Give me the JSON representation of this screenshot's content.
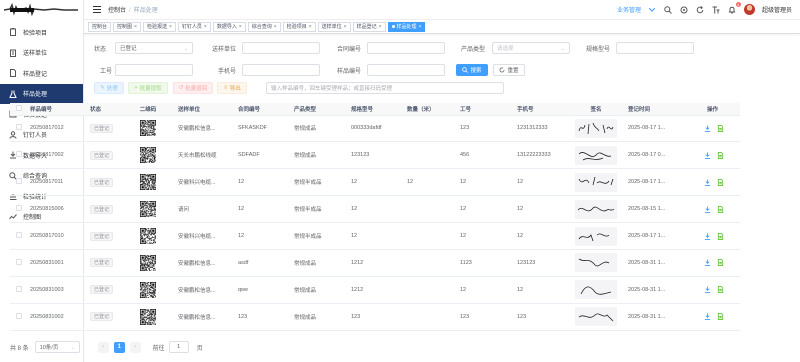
{
  "sidebar": {
    "items": [
      {
        "label": "检验项目",
        "icon": "clipboard-icon",
        "active": false
      },
      {
        "label": "送样单位",
        "icon": "building-icon",
        "active": false
      },
      {
        "label": "样品登记",
        "icon": "document-icon",
        "active": false
      },
      {
        "label": "样品处理",
        "icon": "flask-icon",
        "active": true
      },
      {
        "label": "检验报送",
        "icon": "report-icon",
        "active": false
      },
      {
        "label": "钉钉人员",
        "icon": "user-icon",
        "active": false
      },
      {
        "label": "数据导入",
        "icon": "import-icon",
        "active": false
      },
      {
        "label": "综合查询",
        "icon": "search-icon",
        "active": false
      },
      {
        "label": "检验统计",
        "icon": "chart-icon",
        "active": false
      },
      {
        "label": "控制图",
        "icon": "graph-icon",
        "active": false
      }
    ]
  },
  "header": {
    "breadcrumb_home": "控制台",
    "breadcrumb_current": "样品处理",
    "biz_menu": "业务管理",
    "notification_count": "1",
    "user_name": "超级管理员"
  },
  "tabs": [
    {
      "label": "控制台",
      "active": false
    },
    {
      "label": "控制图",
      "active": false
    },
    {
      "label": "检验报送",
      "active": false
    },
    {
      "label": "钉钉人员",
      "active": false
    },
    {
      "label": "数据导入",
      "active": false
    },
    {
      "label": "综合查询",
      "active": false
    },
    {
      "label": "检验项目",
      "active": false
    },
    {
      "label": "送样单位",
      "active": false
    },
    {
      "label": "样品登记",
      "active": false
    },
    {
      "label": "样品处理",
      "active": true
    }
  ],
  "filters": {
    "status_label": "状态",
    "status_value": "已登记",
    "unit_label": "送样单位",
    "contract_label": "合同编号",
    "product_type_label": "产品类型",
    "product_type_placeholder": "请选择",
    "spec_label": "规格型号",
    "worker_label": "工号",
    "phone_label": "手机号",
    "sample_label": "样品编号",
    "search_label": "搜索",
    "reset_label": "重置"
  },
  "toolbar": {
    "process_label": "处理",
    "batch_label": "批量提取",
    "batch_return_label": "批量退回",
    "export_label": "导出",
    "scan_placeholder": "输入样品编号，回车键受理样品；或直接扫码受理"
  },
  "table": {
    "headers": [
      "样品编号",
      "状态",
      "二维码",
      "送样单位",
      "合同编号",
      "产品类型",
      "规格型号",
      "数量（米）",
      "工号",
      "手机号",
      "签名",
      "登记时间",
      "操作"
    ],
    "rows": [
      {
        "sample": "20250817012",
        "status": "已登记",
        "unit": "安徽鹏松信息...",
        "contract": "SFKASKDF",
        "type": "常规成品",
        "spec": "000333dafdf",
        "qty": "",
        "worker": "123",
        "phone": "1231312333",
        "time": "2025-08-17 1..."
      },
      {
        "sample": "20250817002",
        "status": "已登记",
        "unit": "天长市鹏松线缆",
        "contract": "SDFADF",
        "type": "常规成品",
        "spec": "123123",
        "qty": "",
        "worker": "456",
        "phone": "13122223333",
        "time": "2025-08-17 0..."
      },
      {
        "sample": "20250817011",
        "status": "已登记",
        "unit": "安徽科兴电缆...",
        "contract": "12",
        "type": "常规半成品",
        "spec": "12",
        "qty": "12",
        "worker": "12",
        "phone": "12",
        "time": "2025-08-17 1..."
      },
      {
        "sample": "20250815006",
        "status": "已登记",
        "unit": "请问",
        "contract": "12",
        "type": "常规半成品",
        "spec": "12",
        "qty": "",
        "worker": "12",
        "phone": "12",
        "time": "2025-08-15 1..."
      },
      {
        "sample": "20250817010",
        "status": "已登记",
        "unit": "安徽科兴电缆...",
        "contract": "12",
        "type": "常规半成品",
        "spec": "12",
        "qty": "",
        "worker": "12",
        "phone": "12",
        "time": "2025-08-17 1..."
      },
      {
        "sample": "20250831001",
        "status": "已登记",
        "unit": "安徽鹏松信息...",
        "contract": "asdf",
        "type": "常规成品",
        "spec": "1212",
        "qty": "",
        "worker": "1123",
        "phone": "123123",
        "time": "2025-08-31 1..."
      },
      {
        "sample": "20250831003",
        "status": "已登记",
        "unit": "安徽鹏松信息...",
        "contract": "qwe",
        "type": "常规成品",
        "spec": "1212",
        "qty": "",
        "worker": "12",
        "phone": "12",
        "time": "2025-08-31 1..."
      },
      {
        "sample": "20250831002",
        "status": "已登记",
        "unit": "安徽鹏松信息...",
        "contract": "123",
        "type": "常规成品",
        "spec": "123",
        "qty": "",
        "worker": "123",
        "phone": "123",
        "time": "2025-08-31 1..."
      }
    ]
  },
  "pager": {
    "total": "共 8 条",
    "page_size": "10条/页",
    "current": "1",
    "goto_label": "前往",
    "goto_value": "1",
    "page_suffix": "页"
  }
}
